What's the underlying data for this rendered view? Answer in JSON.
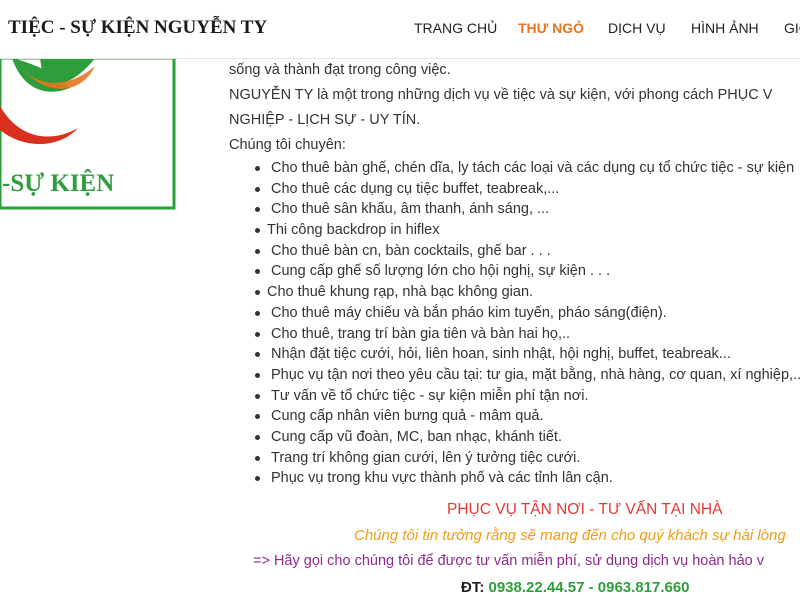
{
  "header": {
    "brand": "TIỆC - SỰ KIỆN NGUYỄN TY",
    "nav": [
      {
        "label": "TRANG CHỦ",
        "active": false
      },
      {
        "label": "THƯ NGỎ",
        "active": true
      },
      {
        "label": "DỊCH VỤ",
        "active": false
      },
      {
        "label": "HÌNH ẢNH",
        "active": false
      },
      {
        "label": "GIỚ",
        "active": false
      }
    ]
  },
  "logo": {
    "text": "-SỰ KIỆN",
    "colors": {
      "green": "#2e9e3c",
      "red": "#d9301f",
      "orange": "#e8741f"
    }
  },
  "intro": {
    "line1": "sống và thành đạt trong công việc.",
    "line2": "NGUYỄN TY là một trong những dịch vụ về tiệc và sự kiện, với phong cách PHỤC V",
    "line3": "NGHIỆP - LỊCH SỰ - UY TÍN.",
    "line4": "Chúng tôi chuyên:"
  },
  "services": [
    "Cho thuê bàn ghế, chén dĩa, ly tách các loại và các dụng cụ tổ chức tiệc - sự kiện",
    "Cho thuê các dụng cụ tiệc buffet, teabreak,...",
    "Cho thuê sân khấu, âm thanh, ánh sáng, ...",
    "Thi công backdrop in hiflex",
    "Cho thuê bàn cn, bàn cocktails, ghế bar . . .",
    "Cung cấp ghế số lượng lớn cho hội nghị, sự kiện . . .",
    "Cho thuê  khung rạp, nhà bạc không gian.",
    "Cho thuê máy chiếu và bắn pháo kim tuyến, pháo sáng(điện).",
    "Cho thuê, trang trí bàn gia tiên và bàn hai họ,..",
    "Nhận đặt tiệc cưới, hỏi, liên hoan, sinh nhật, hội nghị, buffet, teabreak...",
    "Phục vụ tận nơi theo yêu cầu tại: tư gia, mặt bằng, nhà hàng, cơ quan, xí nghiệp,...",
    "Tư vấn về tổ chức tiệc - sự kiện miễn phí tận nơi.",
    "Cung cấp nhân viên bưng quả - mâm quả.",
    "Cung cấp vũ đoàn, MC, ban nhạc, khánh tiết.",
    "Trang trí không gian cưới, lên ý tưởng tiệc cưới.",
    "Phục vụ trong khu vực thành phố và các tỉnh lân cận."
  ],
  "cta": {
    "headline": "PHỤC VỤ TẬN NƠI - TƯ VẤN TẠI NHÀ",
    "commitment": "Chúng tôi tin tưởng rằng sẽ mang đến cho quý khách sự hài lòng",
    "call": "=> Hãy gọi cho chúng tôi để được tư vấn miễn phí, sử dụng dịch vụ hoàn hảo v",
    "phone_label": "ĐT:",
    "phone_numbers": "0938.22.44.57 - 0963.817.660"
  },
  "colors": {
    "nav_active": "#e8741f",
    "headline": "#e53935",
    "commitment": "#f39c12",
    "call": "#8e2a8e",
    "phone": "#2e9e3c"
  }
}
